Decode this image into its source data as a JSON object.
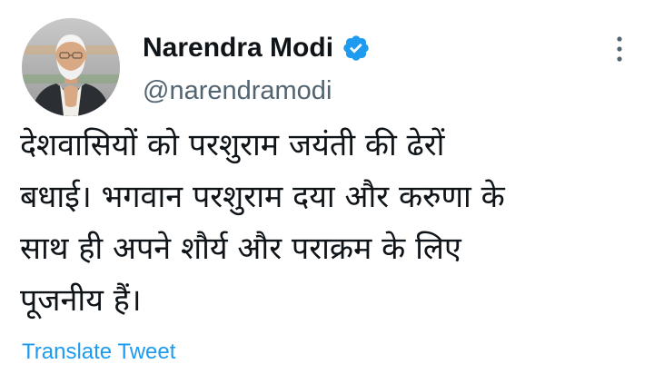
{
  "tweet": {
    "author": {
      "name": "Narendra Modi",
      "handle": "@narendramodi",
      "verified": true,
      "verified_badge_color": "#1d9bf0"
    },
    "text_lines": [
      "देशवासियों को परशुराम जयंती की ढेरों",
      "बधाई। भगवान परशुराम दया और करुणा के",
      "साथ ही अपने शौर्य और पराक्रम के लिए",
      "पूजनीय हैं।"
    ],
    "translate_label": "Translate Tweet",
    "more_icon": "more-vertical-icon"
  },
  "colors": {
    "text": "#0f1419",
    "secondary_text": "#536471",
    "link": "#1d9bf0",
    "background": "#ffffff"
  }
}
